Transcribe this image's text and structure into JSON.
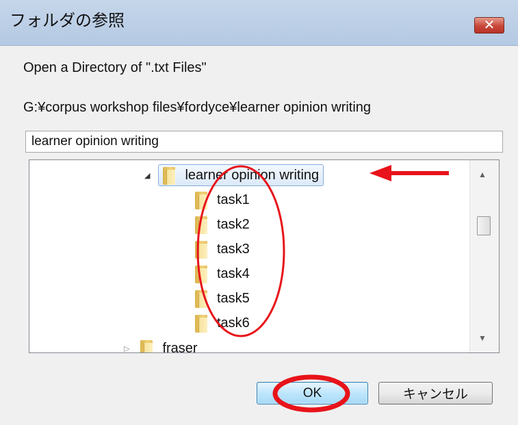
{
  "window": {
    "title": "フォルダの参照",
    "close_label": "✕"
  },
  "dialog": {
    "instruction": "Open a Directory of \".txt Files\"",
    "current_path": "G:¥corpus workshop files¥fordyce¥learner opinion writing",
    "folder_input_value": "learner opinion writing"
  },
  "tree": {
    "items": [
      {
        "label": "learner opinion writing",
        "expander": "expanded",
        "selected": true
      },
      {
        "label": "task1"
      },
      {
        "label": "task2"
      },
      {
        "label": "task3"
      },
      {
        "label": "task4"
      },
      {
        "label": "task5"
      },
      {
        "label": "task6"
      },
      {
        "label": "fraser",
        "expander": "collapsed"
      }
    ]
  },
  "buttons": {
    "ok_label": "OK",
    "cancel_label": "キャンセル"
  },
  "icons": {
    "scroll_up": "▲",
    "scroll_down": "▼",
    "expanded_glyph": "◢",
    "collapsed_glyph": "▷"
  },
  "colors": {
    "annotation_red": "#e8131a",
    "selection_border": "#84acdd",
    "title_bar": "#b9cce4"
  }
}
